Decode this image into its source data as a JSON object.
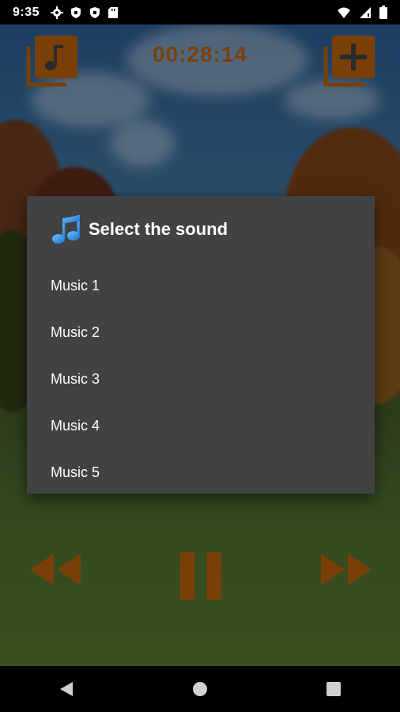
{
  "status_bar": {
    "time": "9:35",
    "left_icons": [
      "gear-icon",
      "shield-icon",
      "shield-icon",
      "sd-card-icon"
    ],
    "right_icons": [
      "wifi-icon",
      "signal-icon",
      "battery-icon"
    ]
  },
  "player": {
    "timer": "00:28:14",
    "accent_color": "#7a3f06",
    "top_buttons": [
      "music-playlist-icon",
      "add-playlist-icon"
    ],
    "bottom_buttons": [
      "rewind-icon",
      "pause-icon",
      "fast-forward-icon"
    ]
  },
  "dialog": {
    "title": "Select the sound",
    "title_icon": "music-note-icon",
    "items": [
      {
        "label": "Music 1"
      },
      {
        "label": "Music 2"
      },
      {
        "label": "Music 3"
      },
      {
        "label": "Music 4"
      },
      {
        "label": "Music 5"
      }
    ],
    "background_color": "#424242"
  },
  "nav_bar": {
    "buttons": [
      "back-icon",
      "home-icon",
      "recents-icon"
    ]
  }
}
